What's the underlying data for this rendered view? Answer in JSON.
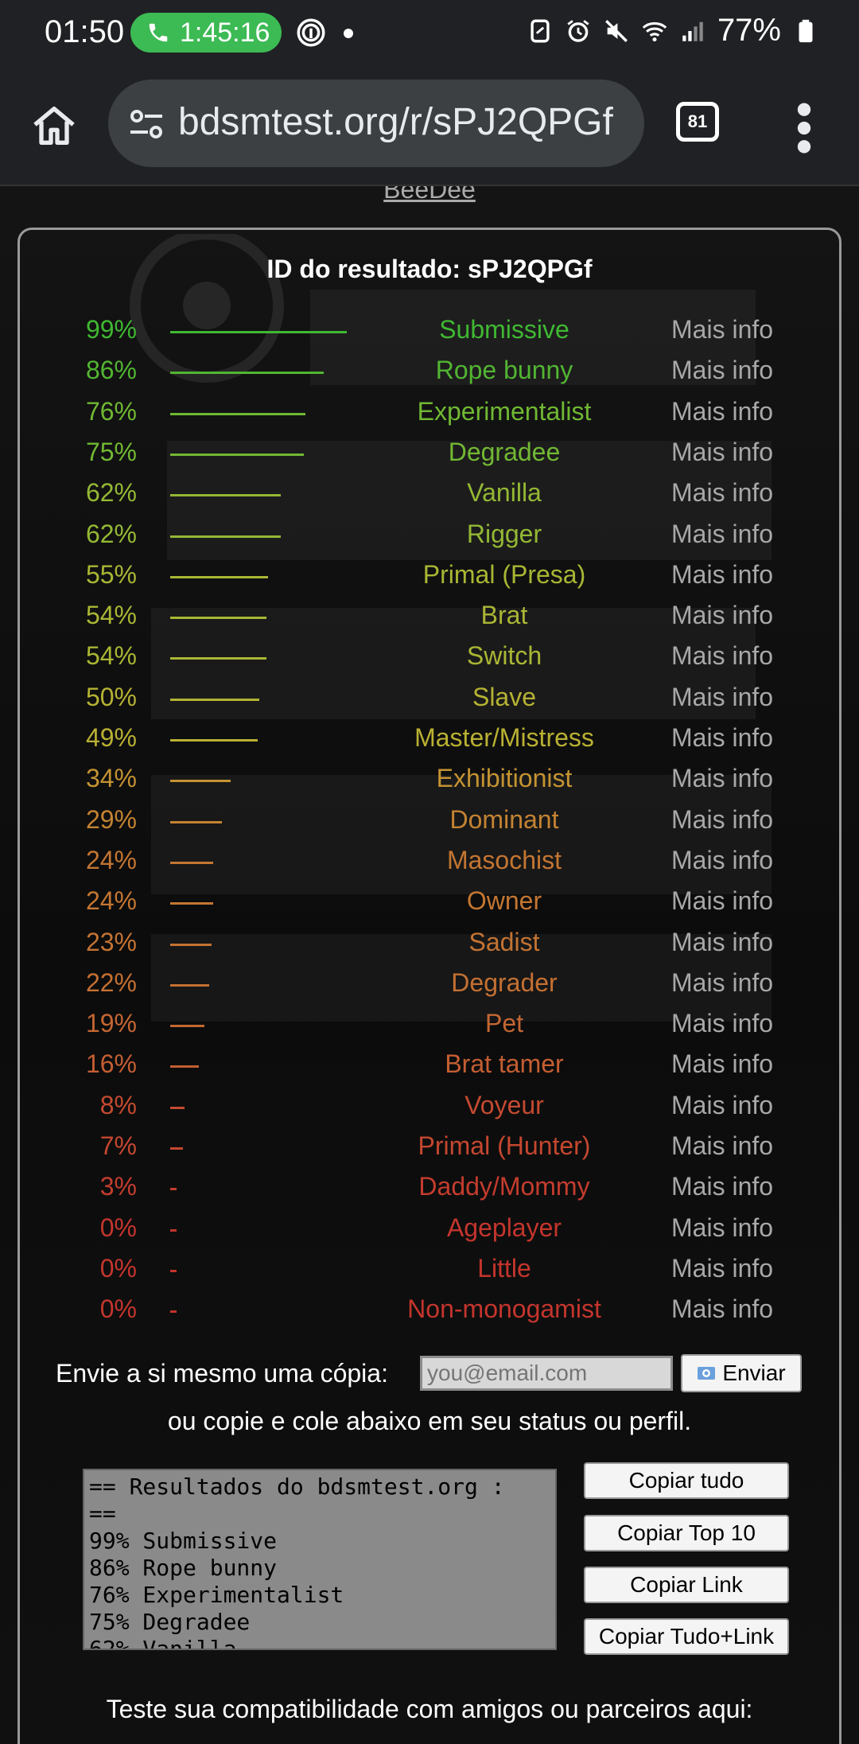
{
  "status_bar": {
    "time": "01:50",
    "call_timer": "1:45:16",
    "battery": "77%",
    "icons": [
      "phone-icon",
      "fingerprint-icon",
      "nfc-icon",
      "alarm-icon",
      "mute-icon",
      "wifi-icon",
      "signal-icon",
      "battery-icon"
    ]
  },
  "browser": {
    "url": "bdsmtest.org/r/sPJ2QPGf",
    "tab_count": "81"
  },
  "page": {
    "username": "BeeDee",
    "result_id": "ID do resultado: sPJ2QPGf",
    "more_label": "Mais info",
    "results": [
      {
        "pct": "99%",
        "value": 99,
        "name": "Submissive",
        "color": "#3fb832"
      },
      {
        "pct": "86%",
        "value": 86,
        "name": "Rope bunny",
        "color": "#52b532"
      },
      {
        "pct": "76%",
        "value": 76,
        "name": "Experimentalist",
        "color": "#70b833"
      },
      {
        "pct": "75%",
        "value": 75,
        "name": "Degradee",
        "color": "#72b833"
      },
      {
        "pct": "62%",
        "value": 62,
        "name": "Vanilla",
        "color": "#94b834"
      },
      {
        "pct": "62%",
        "value": 62,
        "name": "Rigger",
        "color": "#94b834"
      },
      {
        "pct": "55%",
        "value": 55,
        "name": "Primal (Presa)",
        "color": "#a9b634"
      },
      {
        "pct": "54%",
        "value": 54,
        "name": "Brat",
        "color": "#aab634"
      },
      {
        "pct": "54%",
        "value": 54,
        "name": "Switch",
        "color": "#aab634"
      },
      {
        "pct": "50%",
        "value": 50,
        "name": "Slave",
        "color": "#b5b233"
      },
      {
        "pct": "49%",
        "value": 49,
        "name": "Master/Mistress",
        "color": "#b9b033"
      },
      {
        "pct": "34%",
        "value": 34,
        "name": "Exhibitionist",
        "color": "#c49332"
      },
      {
        "pct": "29%",
        "value": 29,
        "name": "Dominant",
        "color": "#c48332"
      },
      {
        "pct": "24%",
        "value": 24,
        "name": "Masochist",
        "color": "#c47632"
      },
      {
        "pct": "24%",
        "value": 24,
        "name": "Owner",
        "color": "#c47632"
      },
      {
        "pct": "23%",
        "value": 23,
        "name": "Sadist",
        "color": "#c47332"
      },
      {
        "pct": "22%",
        "value": 22,
        "name": "Degrader",
        "color": "#c47032"
      },
      {
        "pct": "19%",
        "value": 19,
        "name": "Pet",
        "color": "#c46632"
      },
      {
        "pct": "16%",
        "value": 16,
        "name": "Brat tamer",
        "color": "#c45e32"
      },
      {
        "pct": "8%",
        "value": 8,
        "name": "Voyeur",
        "color": "#c44a30"
      },
      {
        "pct": "7%",
        "value": 7,
        "name": "Primal (Hunter)",
        "color": "#c4472f"
      },
      {
        "pct": "3%",
        "value": 3,
        "name": "Daddy/Mommy",
        "color": "#c43c2e"
      },
      {
        "pct": "0%",
        "value": 0,
        "name": "Ageplayer",
        "color": "#c4352d"
      },
      {
        "pct": "0%",
        "value": 0,
        "name": "Little",
        "color": "#c4352d"
      },
      {
        "pct": "0%",
        "value": 0,
        "name": "Non-monogamist",
        "color": "#c4352d"
      }
    ],
    "email": {
      "label": "Envie a si mesmo uma cópia:",
      "placeholder": "you@email.com",
      "send": "Enviar"
    },
    "copy_note": "ou copie e cole abaixo em seu status ou perfil.",
    "textarea": "== Resultados do bdsmtest.org :\n==\n99% Submissive\n86% Rope bunny\n76% Experimentalist\n75% Degradee\n62% Vanilla",
    "buttons": {
      "copy_all": "Copiar tudo",
      "copy_top10": "Copiar Top 10",
      "copy_link": "Copiar Link",
      "copy_all_link": "Copiar Tudo+Link"
    },
    "compat": "Teste sua compatibilidade com amigos ou parceiros aqui:"
  }
}
